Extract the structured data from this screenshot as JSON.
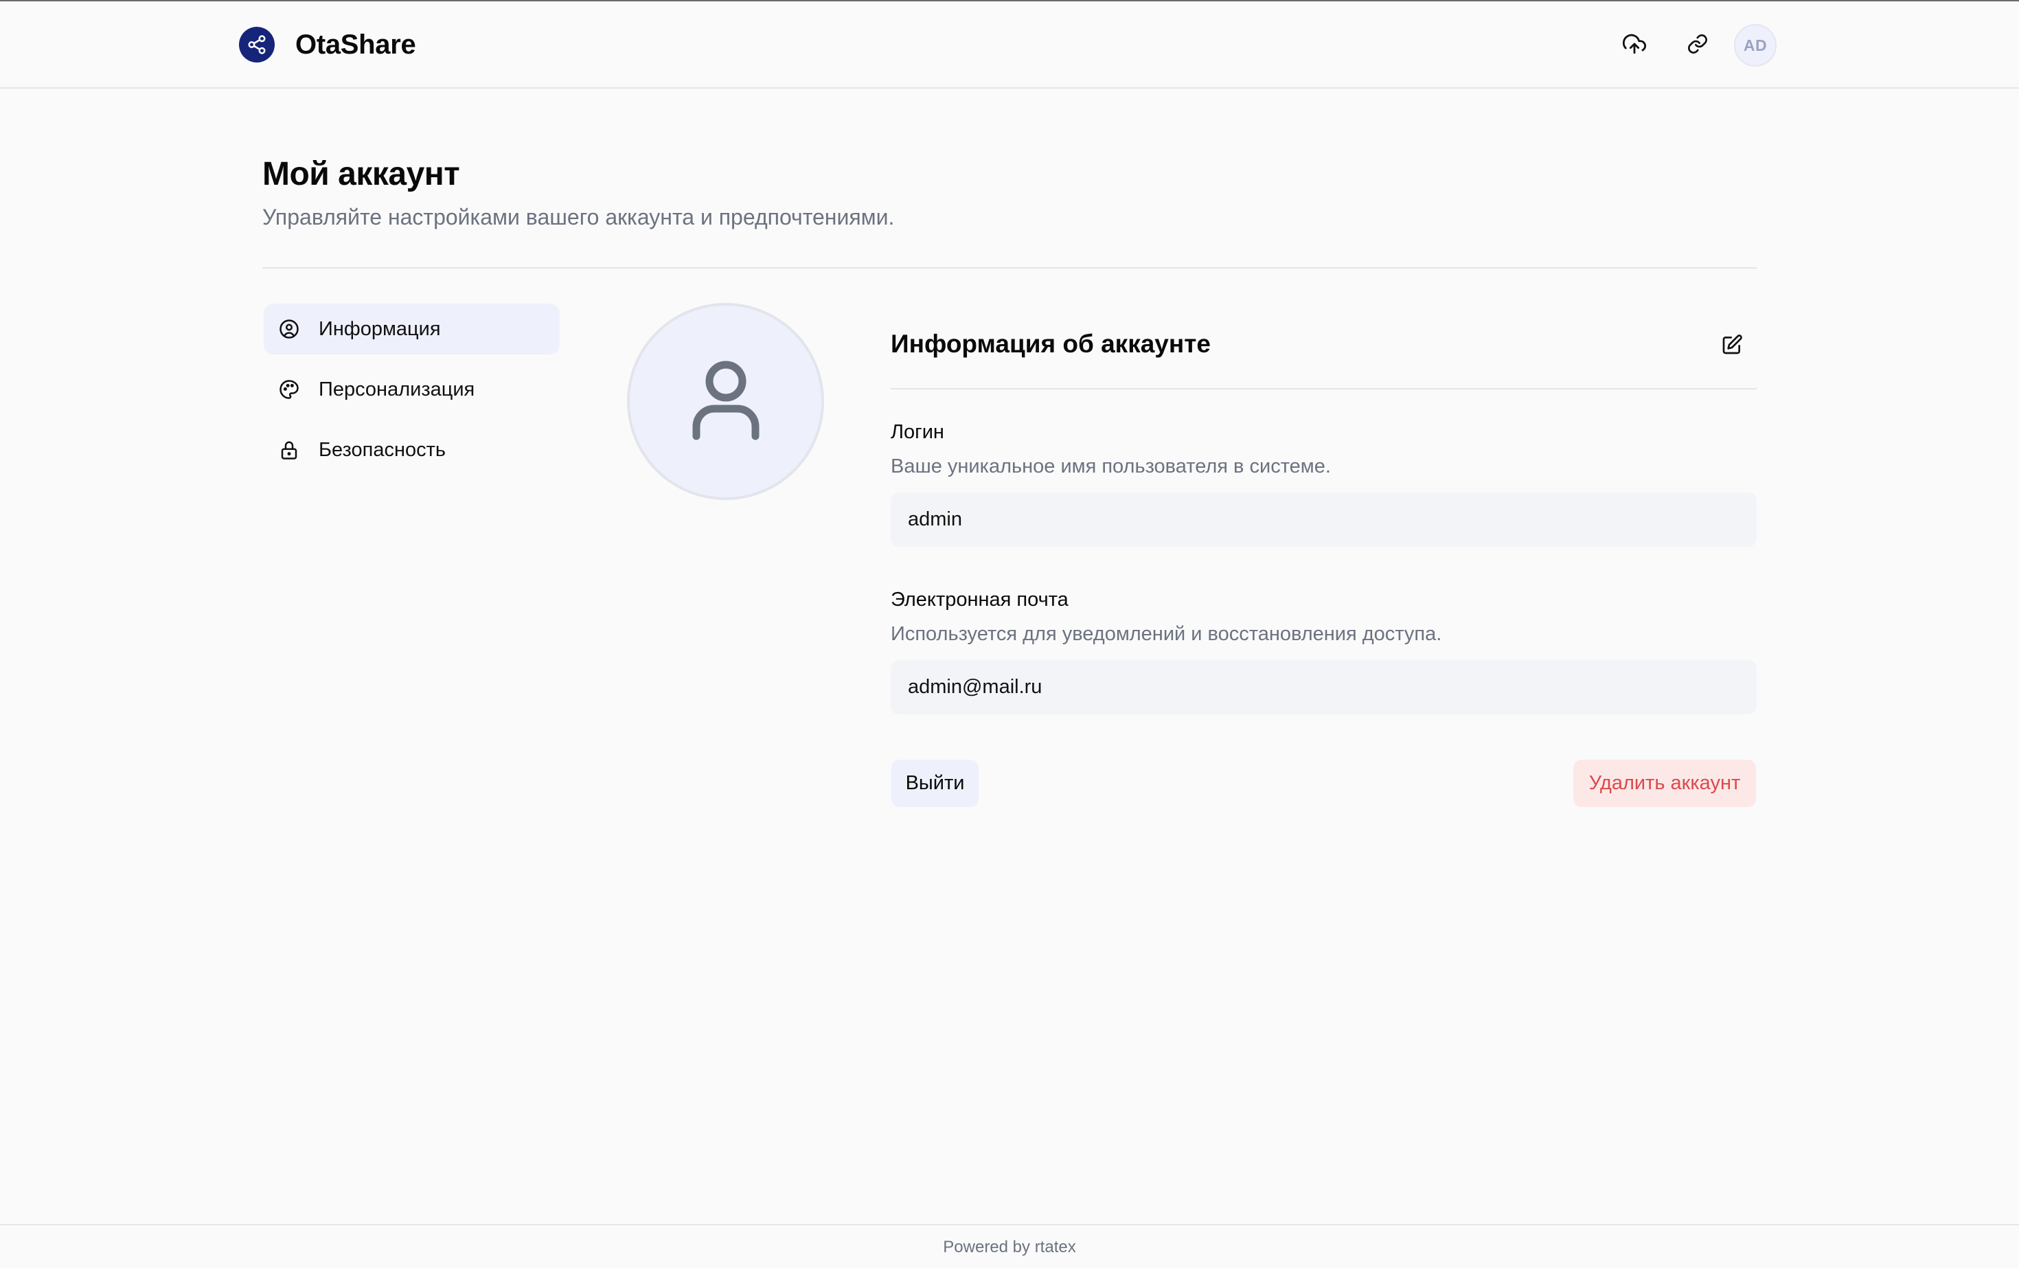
{
  "header": {
    "brand": "OtaShare",
    "avatar_initials": "AD",
    "icons": [
      "share-icon",
      "cloud-upload-icon",
      "link-icon"
    ]
  },
  "page": {
    "title": "Мой аккаунт",
    "subtitle": "Управляйте настройками вашего аккаунта и предпочтениями."
  },
  "sidebar": {
    "items": [
      {
        "label": "Информация",
        "icon": "user-circle-icon",
        "active": true
      },
      {
        "label": "Персонализация",
        "icon": "palette-icon",
        "active": false
      },
      {
        "label": "Безопасность",
        "icon": "lock-icon",
        "active": false
      }
    ]
  },
  "account": {
    "section_title": "Информация об аккаунте",
    "login": {
      "label": "Логин",
      "description": "Ваше уникальное имя пользователя в системе.",
      "value": "admin"
    },
    "email": {
      "label": "Электронная почта",
      "description": "Используется для уведомлений и восстановления доступа.",
      "value": "admin@mail.ru"
    },
    "logout_label": "Выйти",
    "delete_label": "Удалить аккаунт"
  },
  "footer": {
    "text": "Powered by rtatex"
  },
  "colors": {
    "brand": "#16257a",
    "active_bg": "#eef0fb",
    "danger_text": "#dc4a4a",
    "danger_bg": "#fde8e8",
    "muted_text": "#6b7280"
  }
}
